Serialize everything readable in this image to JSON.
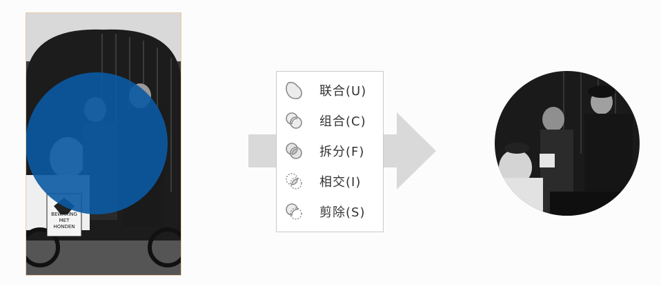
{
  "menu": {
    "items": [
      {
        "label": "联合(U)",
        "icon": "union-shapes-icon"
      },
      {
        "label": "组合(C)",
        "icon": "combine-shapes-icon"
      },
      {
        "label": "拆分(F)",
        "icon": "fragment-shapes-icon"
      },
      {
        "label": "相交(I)",
        "icon": "intersect-shapes-icon"
      },
      {
        "label": "剪除(S)",
        "icon": "subtract-shapes-icon"
      }
    ]
  },
  "photo": {
    "sign_text": "BEWAKING MET HONDEN"
  },
  "colors": {
    "circle_overlay": "#0b5aa3",
    "arrow": "#d9d9d9",
    "menu_border": "#c9c9c9",
    "icon_gray": "#8a8a8a"
  }
}
